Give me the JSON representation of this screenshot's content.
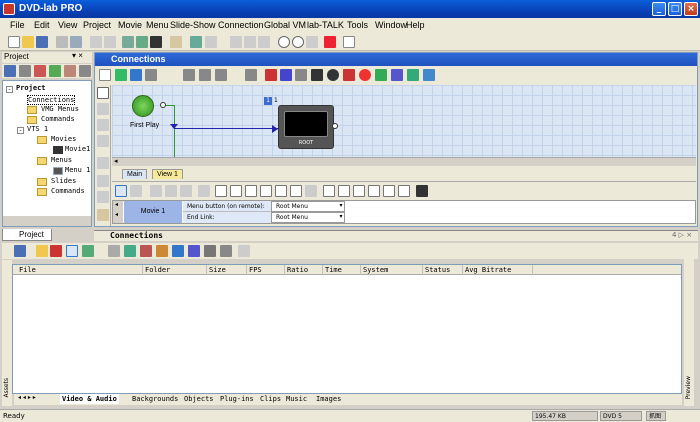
{
  "window": {
    "title": "DVD-lab PRO"
  },
  "menu": [
    "File",
    "Edit",
    "View",
    "Project",
    "Movie",
    "Menu",
    "Slide-Show",
    "Connection",
    "Global VM",
    "lab-TALK",
    "Tools",
    "Window",
    "Help"
  ],
  "project_panel": {
    "title": "Project",
    "tree": [
      "Project",
      "Connections",
      "VMG Menus",
      "Commands",
      "VTS 1",
      "Movies",
      "Movie1",
      "Menus",
      "Menu 1",
      "Slides",
      "Commands"
    ],
    "bottom_tab": "Project"
  },
  "connections": {
    "title": "Connections",
    "first_play": "First Play",
    "root_label": "ROOT",
    "menu_badge": "1",
    "tabs": [
      "Main",
      "View 1"
    ],
    "row": {
      "name": "Movie 1",
      "prop1_label": "Menu button (on remote):",
      "prop1_value": "Root Menu",
      "prop2_label": "End Link:",
      "prop2_value": "Root Menu"
    }
  },
  "bottom_panel": {
    "title": "Connections",
    "controls": "4 ▷ ×",
    "columns": [
      "File",
      "Folder",
      "Size",
      "FPS",
      "Ratio",
      "Time",
      "System",
      "Status",
      "Avg Bitrate"
    ],
    "left_side_label": "Assets",
    "right_side_label": "Preview",
    "tabs": [
      "Video & Audio",
      "Backgrounds",
      "Objects",
      "Plug-ins",
      "Clips",
      "Music",
      "Images"
    ]
  },
  "status": {
    "text": "Ready",
    "disk": "195.47 KB",
    "format": "DVD 5",
    "flag": "抓图"
  },
  "colors": {
    "accent": "#0a5fd8",
    "grid": "#dbe6f5",
    "movie_cell": "#9db5e6"
  }
}
